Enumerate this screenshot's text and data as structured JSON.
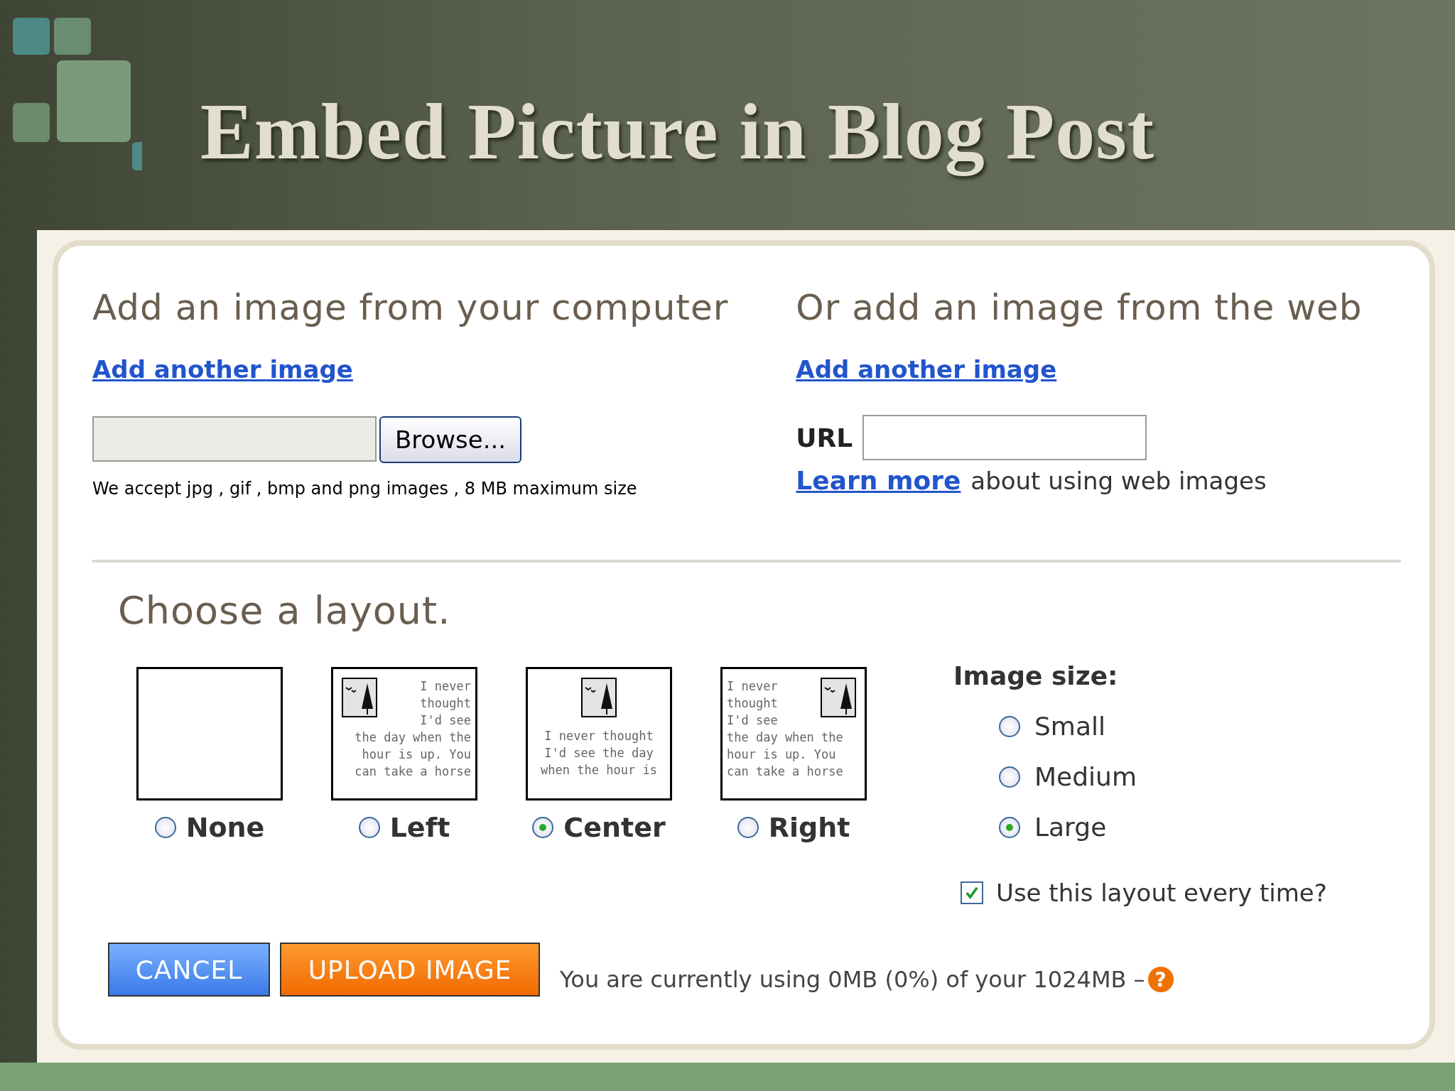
{
  "slide_title": "Embed Picture in Blog Post",
  "computer_section": {
    "heading": "Add an image from your computer",
    "link": "Add another image",
    "button": "Browse...",
    "note": "We accept jpg , gif , bmp and png images , 8 MB maximum size"
  },
  "web_section": {
    "heading": "Or add an image from the web",
    "link": "Add another image",
    "url_label": "URL",
    "learn_more_link": "Learn more",
    "learn_more_text": "about using web images"
  },
  "layout_section": {
    "heading": "Choose a layout.",
    "layouts": [
      {
        "kind": "none",
        "label": "None",
        "selected": false
      },
      {
        "kind": "left",
        "label": "Left",
        "selected": false,
        "lines": [
          "I never",
          "thought",
          "I'd see",
          "the day when the",
          "hour is up. You",
          "can take a horse"
        ]
      },
      {
        "kind": "center",
        "label": "Center",
        "selected": true,
        "lines": [
          "I never thought",
          "I'd see the day",
          "when the hour is"
        ]
      },
      {
        "kind": "right",
        "label": "Right",
        "selected": false,
        "lines": [
          "I never",
          "thought",
          "I'd see",
          "the day when the",
          "hour is up. You",
          "can take a horse"
        ]
      }
    ],
    "size_label": "Image size:",
    "sizes": [
      {
        "label": "Small",
        "selected": false
      },
      {
        "label": "Medium",
        "selected": false
      },
      {
        "label": "Large",
        "selected": true
      }
    ],
    "remember": {
      "label": "Use this layout every time?",
      "checked": true
    }
  },
  "buttons": {
    "cancel": "CANCEL",
    "upload": "UPLOAD IMAGE"
  },
  "usage": {
    "text": "You are currently using 0MB (0%) of your 1024MB –",
    "help": "?"
  }
}
